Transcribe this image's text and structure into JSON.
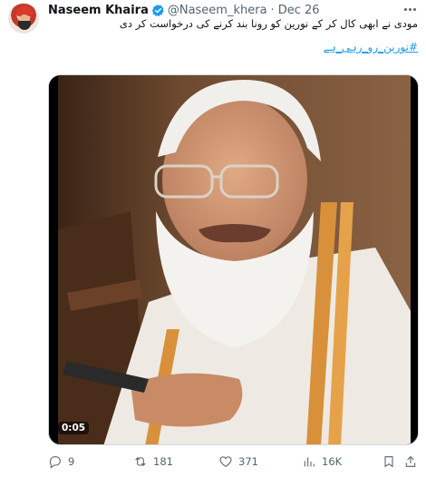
{
  "tweet": {
    "author_name": "Naseem Khaira",
    "handle": "@Naseem_khera",
    "separator": "·",
    "date": "Dec 26",
    "text": "مودی نے ابھی کال کر کے نورین کو رونا بند کرنے کی درخواست کر دی",
    "hashtag": "#نورین_رو_رہی_ہے"
  },
  "video": {
    "duration": "0:05"
  },
  "actions": {
    "replies": "9",
    "reposts": "181",
    "likes": "371",
    "views": "16K"
  },
  "icons": {
    "verified": "verified-badge-icon",
    "more": "more-options-icon",
    "reply": "reply-icon",
    "repost": "repost-icon",
    "like": "heart-icon",
    "views": "bar-chart-icon",
    "bookmark": "bookmark-icon",
    "share": "share-icon"
  },
  "colors": {
    "accent": "#1d9bf0",
    "text": "#0f1419",
    "muted": "#536471"
  }
}
